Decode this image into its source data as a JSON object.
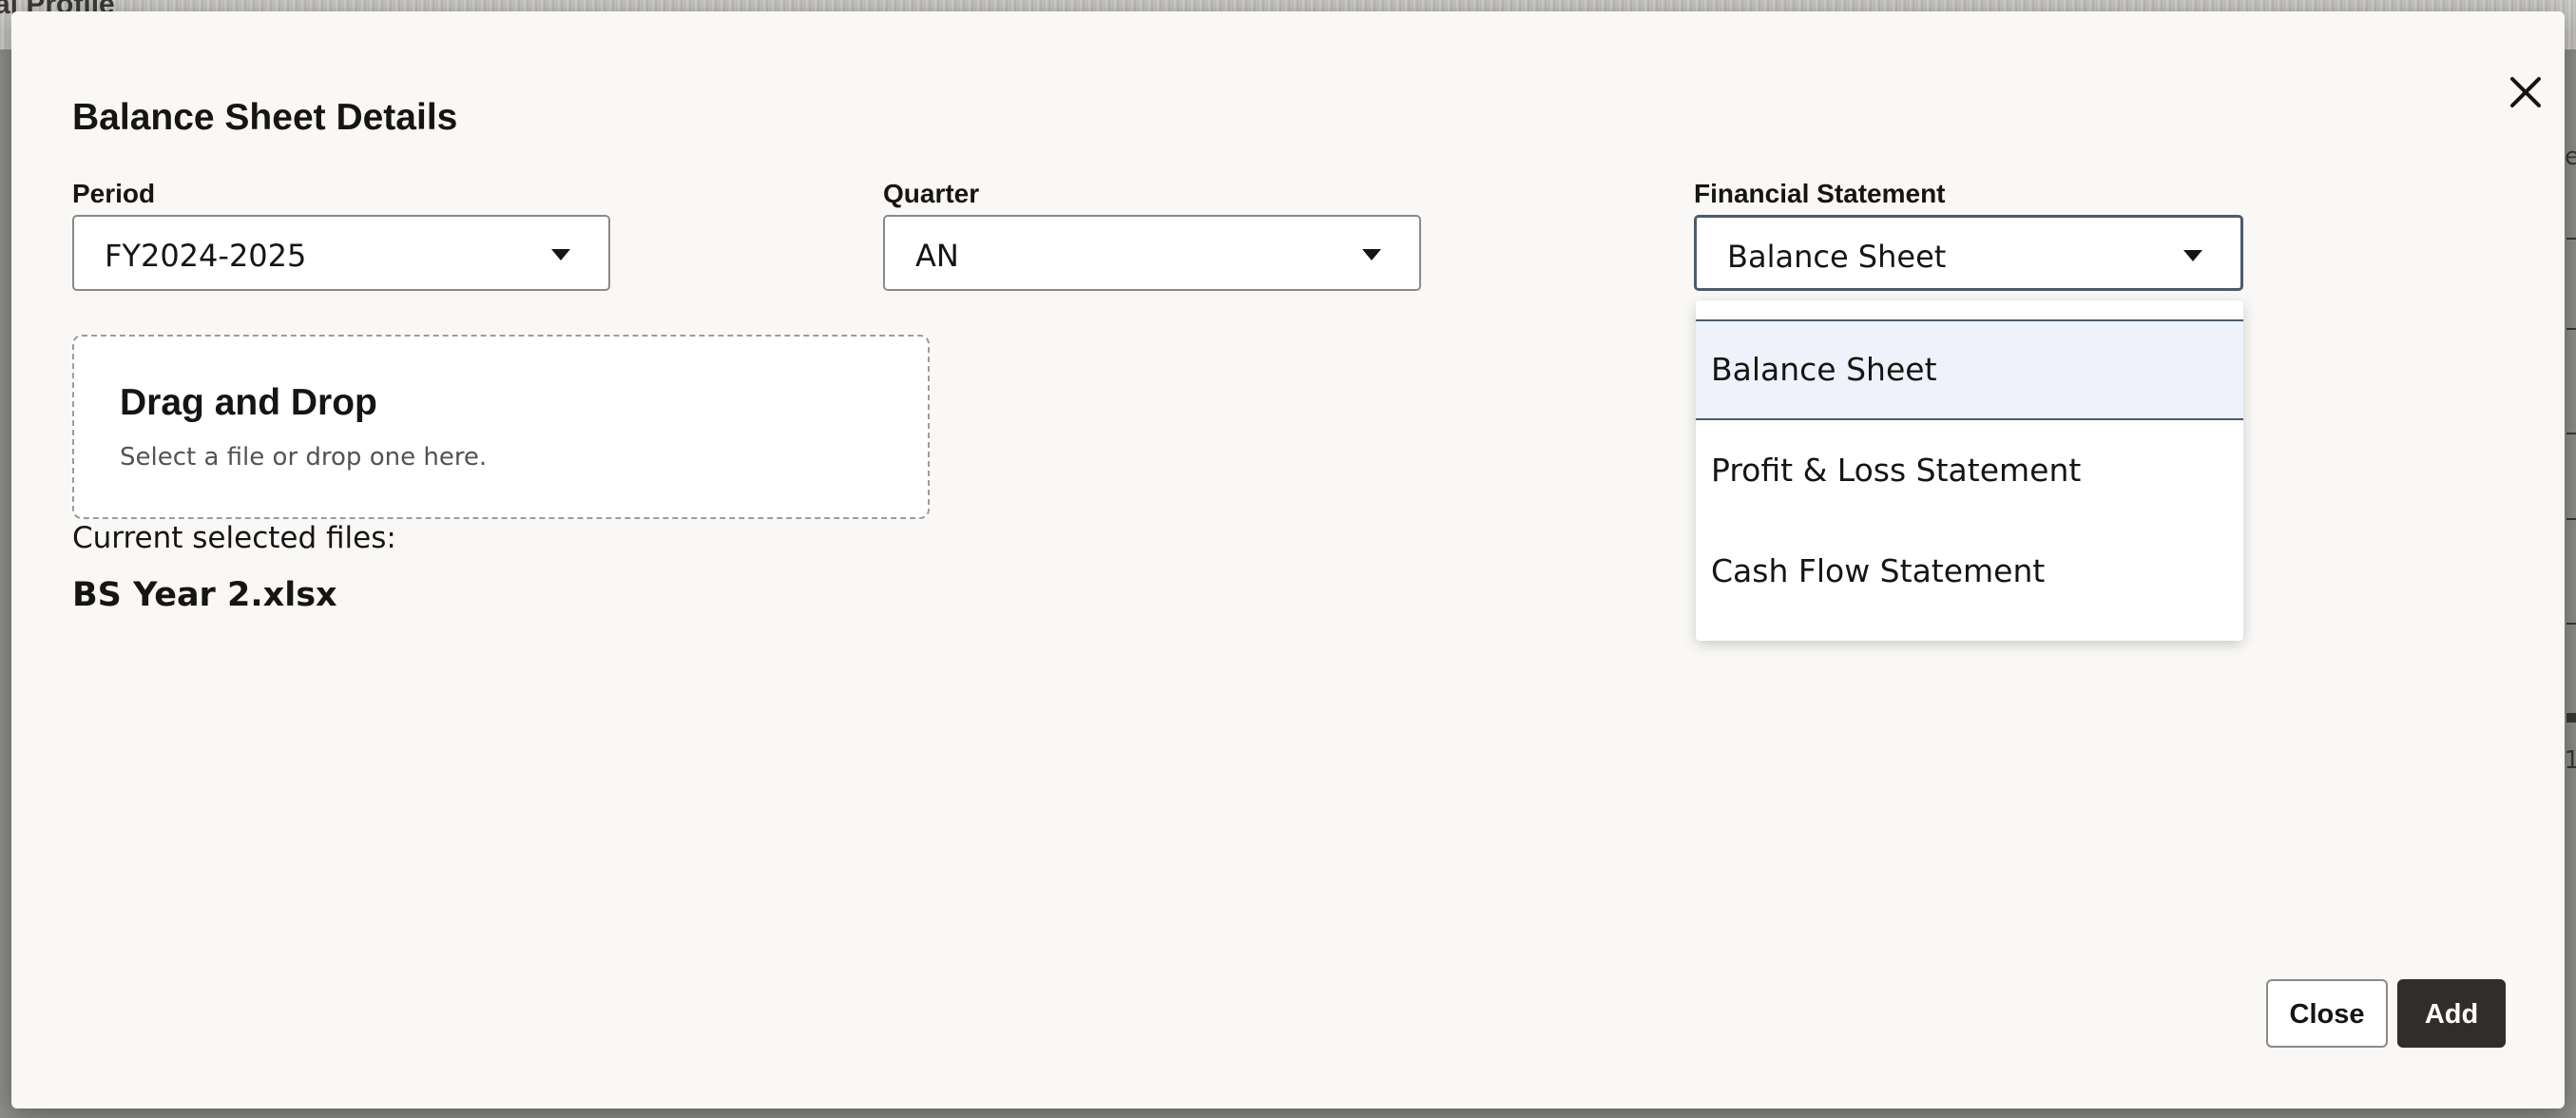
{
  "background": {
    "page_title_fragment": "al Profile",
    "right_edge_text": [
      "Se",
      "1"
    ]
  },
  "modal": {
    "title": "Balance Sheet Details",
    "close_icon": "close-icon",
    "period": {
      "label": "Period",
      "value": "FY2024-2025"
    },
    "quarter": {
      "label": "Quarter",
      "value": "AN"
    },
    "financial_statement": {
      "label": "Financial Statement",
      "value": "Balance Sheet",
      "options": [
        "Balance Sheet",
        "Profit & Loss Statement",
        "Cash Flow Statement"
      ],
      "selected_index": 0
    },
    "dropzone": {
      "title": "Drag and Drop",
      "subtitle": "Select a file or drop one here."
    },
    "current_files_label": "Current selected files:",
    "files": [
      "BS Year 2.xlsx"
    ],
    "buttons": {
      "close": "Close",
      "add": "Add"
    }
  },
  "colors": {
    "modal_background": "#f9f8f6",
    "focus_border": "#4d5a6e",
    "selected_option_bg": "#eff2fb",
    "primary_button": "#312d2a"
  }
}
